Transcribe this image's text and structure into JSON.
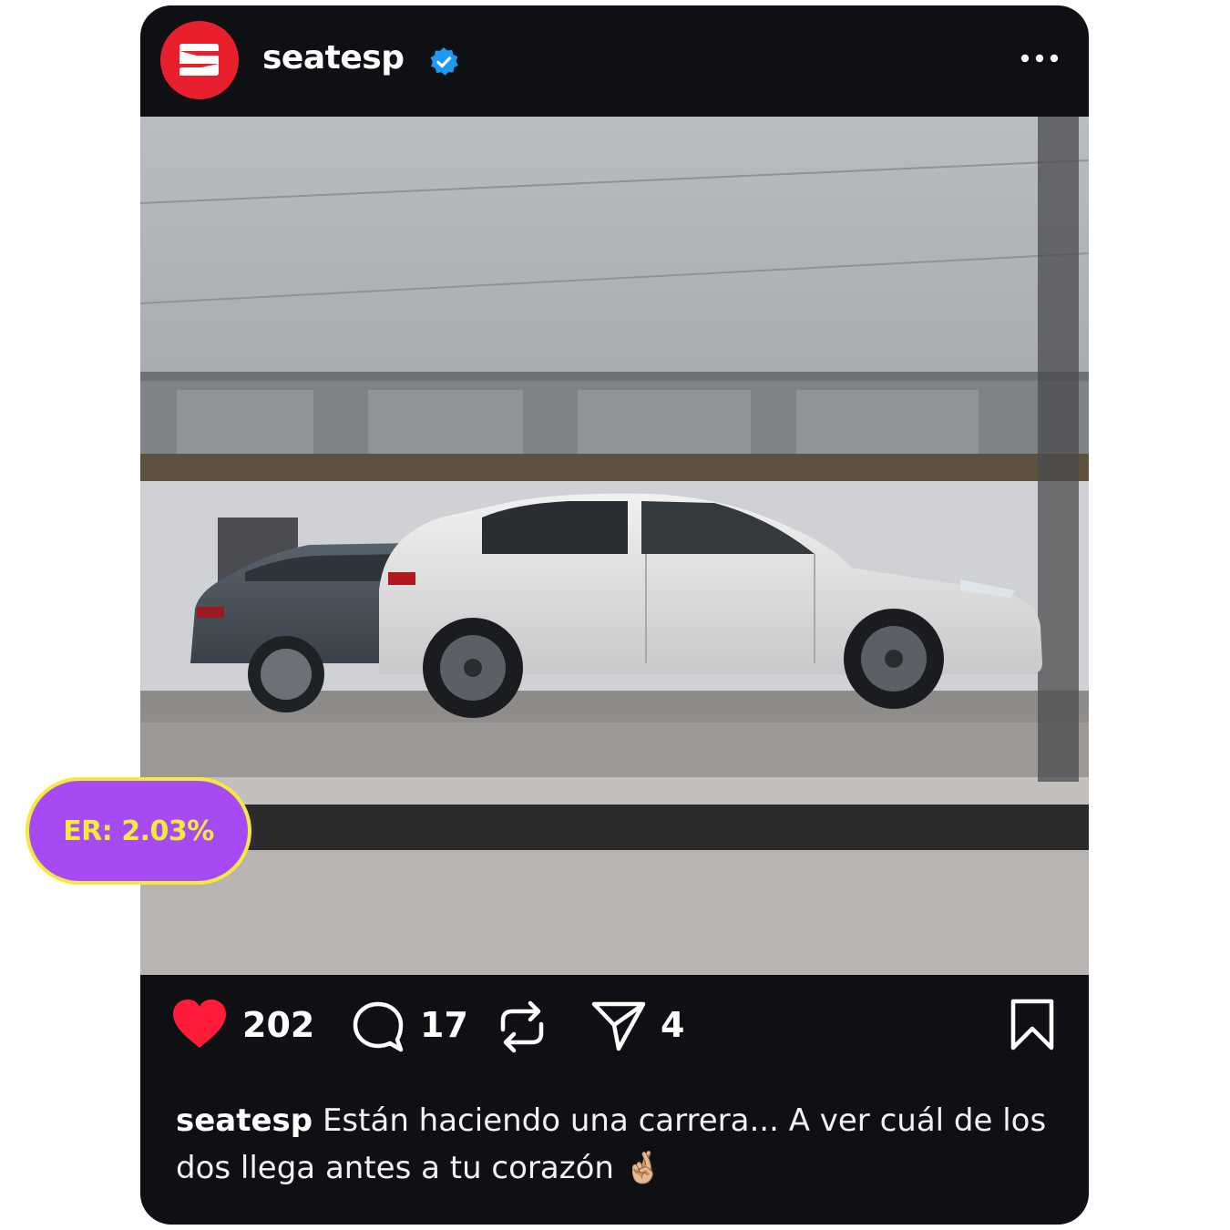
{
  "post": {
    "username": "seatesp",
    "verified": true,
    "avatar_logo": "seat-s-logo",
    "image_description": "seat-cars-photo",
    "likes": "202",
    "comments": "17",
    "reposts": "",
    "shares": "4",
    "caption": {
      "username": "seatesp",
      "text": "Están haciendo una carrera... A ver cuál de los dos llega antes a tu corazón 🤞🏼"
    }
  },
  "badge": {
    "label": "ER: 2.03%"
  },
  "colors": {
    "card_bg": "#0e1014",
    "like_red": "#ff1c3a",
    "verified_blue": "#1d9bf0",
    "badge_purple": "#a64bf4",
    "badge_yellow": "#f4ea3c",
    "avatar_red": "#e8202e"
  },
  "icons": {
    "like": "heart-icon",
    "comment": "comment-bubble-icon",
    "repost": "repost-icon",
    "share": "send-paper-plane-icon",
    "save": "bookmark-icon",
    "more": "more-dots-icon"
  }
}
